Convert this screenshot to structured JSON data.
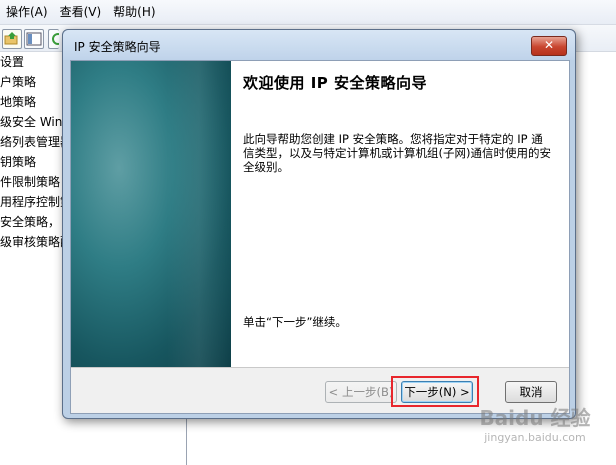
{
  "menubar": {
    "items": [
      "操作(A)",
      "查看(V)",
      "帮助(H)"
    ]
  },
  "tree": {
    "items": [
      "设置",
      "户策略",
      "地策略",
      "级安全 Wind",
      "络列表管理器",
      "钥策略",
      "件限制策略",
      "用程序控制策",
      "安全策略，",
      "级审核策略配"
    ]
  },
  "dialog": {
    "title": "IP 安全策略向导",
    "close_label": "✕",
    "heading": "欢迎使用 IP 安全策略向导",
    "description": "此向导帮助您创建 IP 安全策略。您将指定对于特定的 IP 通信类型，以及与特定计算机或计算机组(子网)通信时使用的安全级别。",
    "continue_text": "单击“下一步”继续。",
    "back_label": "< 上一步(B)",
    "next_label": "下一步(N) >",
    "cancel_label": "取消"
  },
  "colors": {
    "highlight": "#e8262c",
    "banner": "#17565f"
  },
  "watermark": {
    "brand": "Baidu 经验",
    "site": "jingyan.baidu.com"
  }
}
